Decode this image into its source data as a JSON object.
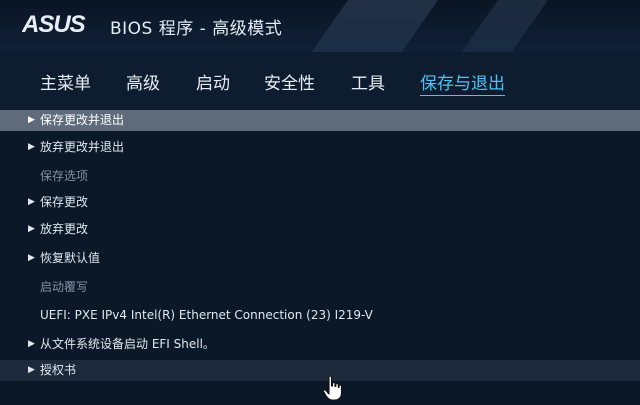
{
  "header": {
    "logo_text": "ASUS",
    "title": "BIOS 程序 - 高级模式"
  },
  "menu": {
    "tabs": [
      {
        "label": "主菜单"
      },
      {
        "label": "高级"
      },
      {
        "label": "启动"
      },
      {
        "label": "安全性"
      },
      {
        "label": "工具"
      },
      {
        "label": "保存与退出"
      }
    ],
    "active": "保存与退出"
  },
  "items": [
    {
      "label": "保存更改并退出",
      "kind": "action",
      "selected": true
    },
    {
      "label": "放弃更改并退出",
      "kind": "action"
    },
    {
      "label": "保存选项",
      "kind": "section"
    },
    {
      "label": "保存更改",
      "kind": "action"
    },
    {
      "label": "放弃更改",
      "kind": "action"
    },
    {
      "label": "恢复默认值",
      "kind": "action"
    },
    {
      "label": "启动覆写",
      "kind": "section"
    },
    {
      "label": "UEFI: PXE IPv4 Intel(R) Ethernet Connection (23) I219-V",
      "kind": "option"
    },
    {
      "label": "从文件系统设备启动 EFI Shell。",
      "kind": "action"
    },
    {
      "label": "授权书",
      "kind": "action"
    }
  ],
  "colors": {
    "background": "#0b1829",
    "accent": "#4cc3f2",
    "selected_row": "#5f6b7a",
    "section_text": "#8390a1"
  },
  "icons": {
    "arrow": "triangle-right-icon",
    "cursor": "hand-pointer-icon"
  }
}
